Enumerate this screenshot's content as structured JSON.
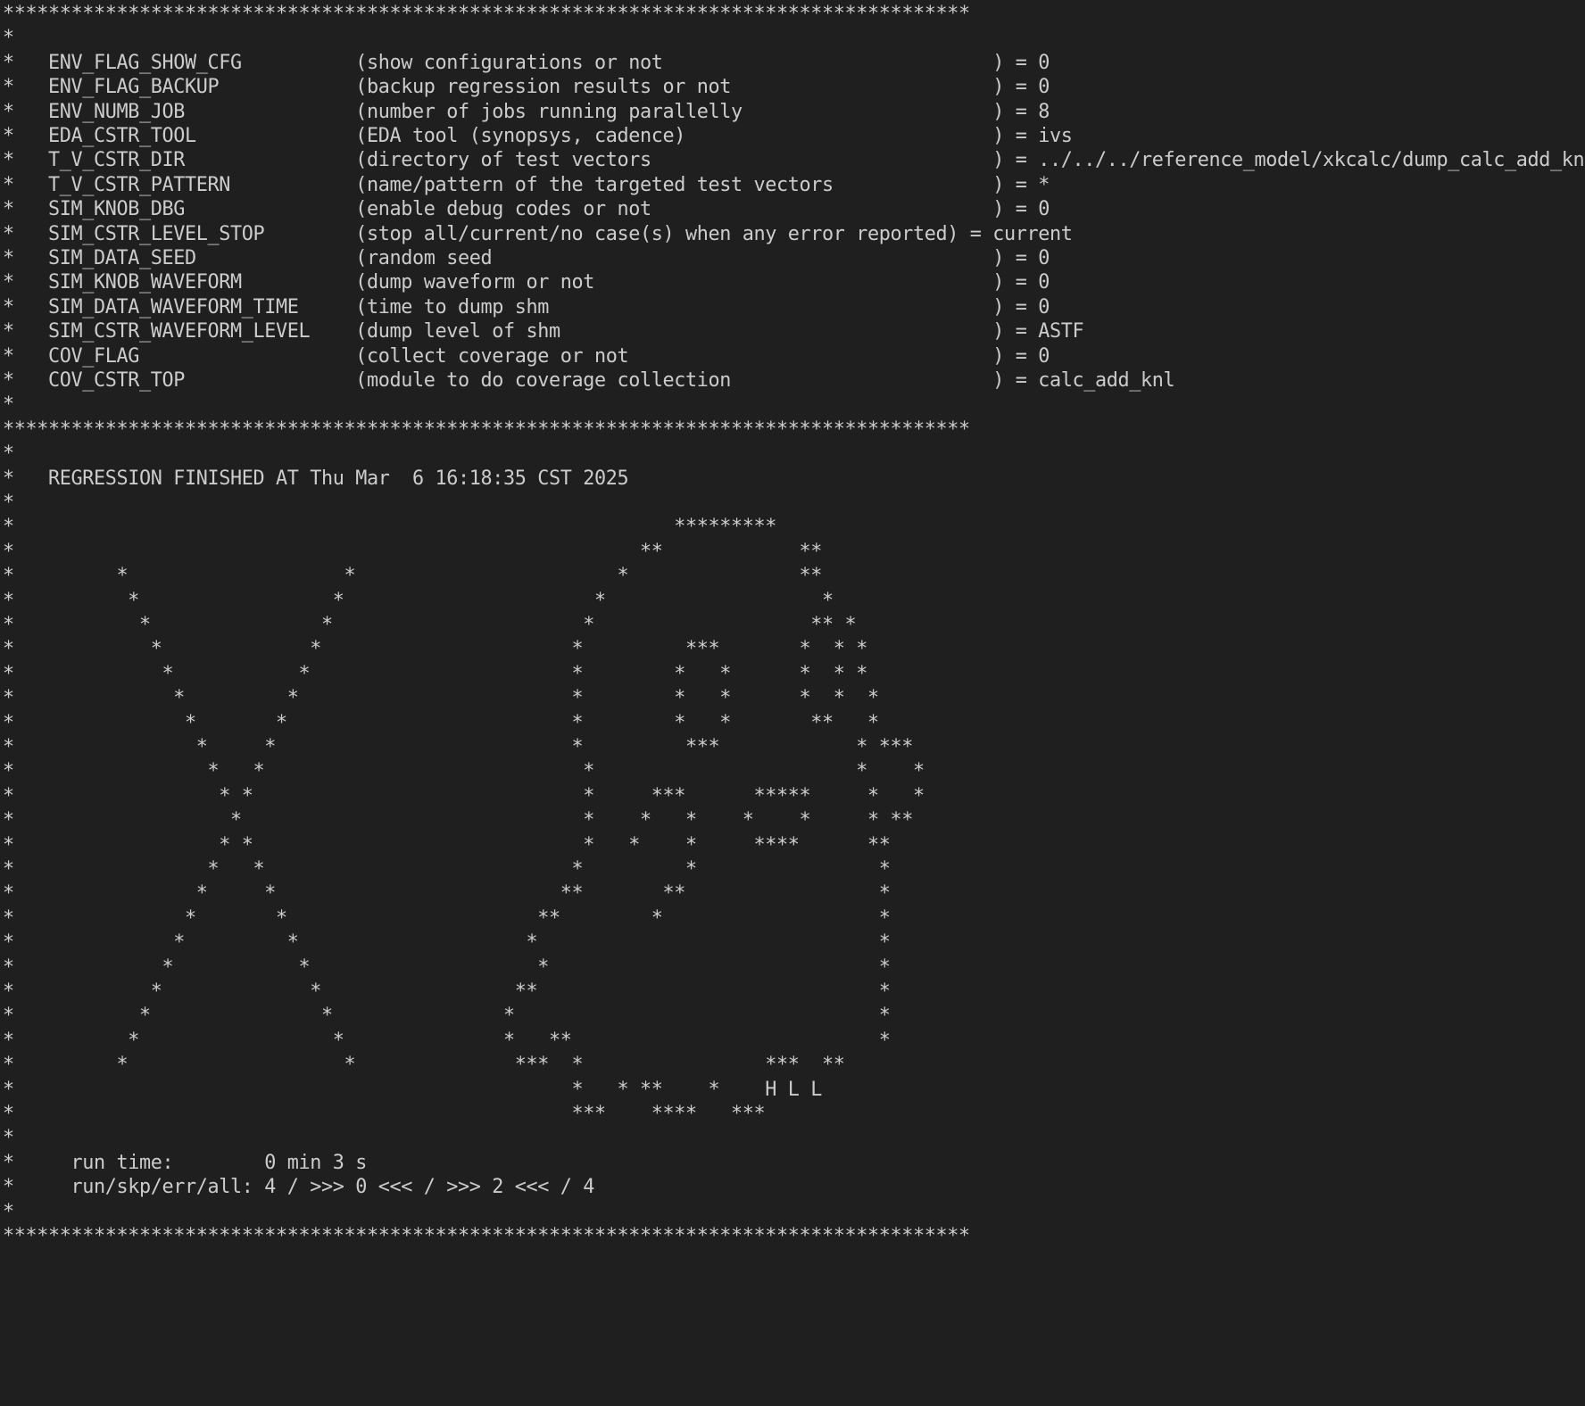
{
  "terminal": {
    "lines": [
      "*************************************************************************************",
      "*",
      "*   ENV_FLAG_SHOW_CFG          (show configurations or not                             ) = 0",
      "*   ENV_FLAG_BACKUP            (backup regression results or not                       ) = 0",
      "*   ENV_NUMB_JOB               (number of jobs running parallelly                      ) = 8",
      "*   EDA_CSTR_TOOL              (EDA tool (synopsys, cadence)                           ) = ivs",
      "*   T_V_CSTR_DIR               (directory of test vectors                              ) = ../../../reference_model/xkcalc/dump_calc_add_knl",
      "*   T_V_CSTR_PATTERN           (name/pattern of the targeted test vectors              ) = *",
      "*   SIM_KNOB_DBG               (enable debug codes or not                              ) = 0",
      "*   SIM_CSTR_LEVEL_STOP        (stop all/current/no case(s) when any error reported) = current",
      "*   SIM_DATA_SEED              (random seed                                            ) = 0",
      "*   SIM_KNOB_WAVEFORM          (dump waveform or not                                   ) = 0",
      "*   SIM_DATA_WAVEFORM_TIME     (time to dump shm                                       ) = 0",
      "*   SIM_CSTR_WAVEFORM_LEVEL    (dump level of shm                                      ) = ASTF",
      "*   COV_FLAG                   (collect coverage or not                                ) = 0",
      "*   COV_CSTR_TOP               (module to do coverage collection                       ) = calc_add_knl",
      "*",
      "*************************************************************************************",
      "*",
      "*   REGRESSION FINISHED AT Thu Mar  6 16:18:35 CST 2025",
      "*",
      "*                                                          *********",
      "*                                                       **            **",
      "*         *                   *                       *               **",
      "*          *                 *                      *                   *",
      "*           *               *                      *                   ** *",
      "*            *             *                      *         ***       *  * *",
      "*             *           *                       *        *   *      *  * *",
      "*              *         *                        *        *   *      *  *  *",
      "*               *       *                         *        *   *       **   *",
      "*                *     *                          *         ***            * ***",
      "*                 *   *                            *                       *    *",
      "*                  * *                             *     ***      *****     *   *",
      "*                   *                              *    *   *    *    *     * **",
      "*                  * *                             *   *    *     ****      **",
      "*                 *   *                           *         *                *",
      "*                *     *                         **       **                 *",
      "*               *       *                      **        *                   *",
      "*              *         *                    *                              *",
      "*             *           *                    *                             *",
      "*            *             *                 **                              *",
      "*           *               *               *                                *",
      "*          *                 *              *   **                           *",
      "*         *                   *              ***  *                ***  **",
      "*                                                 *   * **    *    H L L",
      "*                                                 ***    ****   ***",
      "*",
      "*     run time:        0 min 3 s",
      "*     run/skp/err/all: 4 / >>> 0 <<< / >>> 2 <<< / 4",
      "*",
      "*************************************************************************************"
    ]
  }
}
